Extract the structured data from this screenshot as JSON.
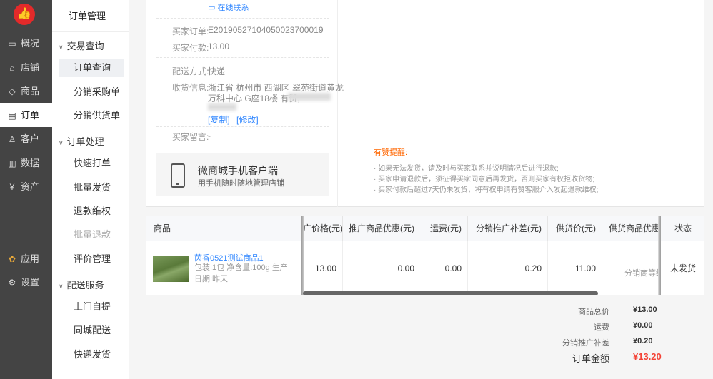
{
  "rail": {
    "logo_glyph": "👍",
    "items": [
      {
        "icon": "monitor-icon",
        "glyph": "▭",
        "label": "概况"
      },
      {
        "icon": "store-icon",
        "glyph": "⌂",
        "label": "店铺"
      },
      {
        "icon": "tag-icon",
        "glyph": "◇",
        "label": "商品"
      },
      {
        "icon": "order-icon",
        "glyph": "▤",
        "label": "订单"
      },
      {
        "icon": "user-icon",
        "glyph": "♙",
        "label": "客户"
      },
      {
        "icon": "chart-icon",
        "glyph": "▥",
        "label": "数据"
      },
      {
        "icon": "yuan-icon",
        "glyph": "¥",
        "label": "资产"
      },
      {
        "icon": "apps-icon",
        "glyph": "✿",
        "label": "应用"
      },
      {
        "icon": "gear-icon",
        "glyph": "⚙",
        "label": "设置"
      }
    ]
  },
  "sub": {
    "title": "订单管理",
    "groups": [
      {
        "label": "交易查询",
        "items": [
          "订单查询",
          "分销采购单",
          "分销供货单"
        ]
      },
      {
        "label": "订单处理",
        "items": [
          "快速打单",
          "批量发货",
          "退款维权",
          "批量退款",
          "评价管理"
        ]
      },
      {
        "label": "配送服务",
        "items": [
          "上门自提",
          "同城配送",
          "快递发货"
        ]
      }
    ]
  },
  "order": {
    "contact_link": "在线联系",
    "buyer_order_label": "买家订单:",
    "buyer_order_value": "E20190527104050023700019",
    "buyer_paid_label": "买家付款:",
    "buyer_paid_value": "13.00",
    "ship_label": "配送方式:",
    "ship_value": "快递",
    "addr_label": "收货信息:",
    "addr_line1": "浙江省 杭州市 西湖区 翠苑街道黄龙",
    "addr_line2": "万科中心    G座18楼 有赞,",
    "copy_link": "[复制]",
    "edit_link": "[修改]",
    "msg_label": "买家留言:",
    "msg_value": "-"
  },
  "app_promo": {
    "title": "微商城手机客户端",
    "subtitle": "用手机随时随地管理店铺"
  },
  "tips": {
    "title": "有赞提醒:",
    "lines": [
      "· 如果无法发货，请及时与买家联系并说明情况后进行退款;",
      "· 买家申请退款后，须征得买家同意后再发货，否则买家有权拒收货物;",
      "· 买家付款后超过7天仍未发货，将有权申请有赞客服介入发起退款维权;"
    ]
  },
  "table": {
    "headers": [
      "商品",
      "广价格(元)",
      "推广商品优惠(元)",
      "运费(元)",
      "分销推广补差(元)",
      "供货价(元)",
      "供货商品优惠",
      "状态"
    ],
    "product_name": "茵香0521测试商品1",
    "product_desc": "包装:1包 净含量:100g 生产日期:昨天",
    "cells": [
      "13.00",
      "0.00",
      "0.00",
      "0.20",
      "11.00",
      "分销商等级",
      "未发货"
    ]
  },
  "summary": [
    {
      "label": "商品总价",
      "value": "¥13.00"
    },
    {
      "label": "运费",
      "value": "¥0.00"
    },
    {
      "label": "分销推广补差",
      "value": "¥0.20"
    },
    {
      "label": "订单金额",
      "value": "¥13.20"
    }
  ],
  "colors": {
    "accent": "#3388ff",
    "brand_red": "#e32a2a",
    "tip_orange": "#ff6600",
    "total_red": "#f44336"
  }
}
